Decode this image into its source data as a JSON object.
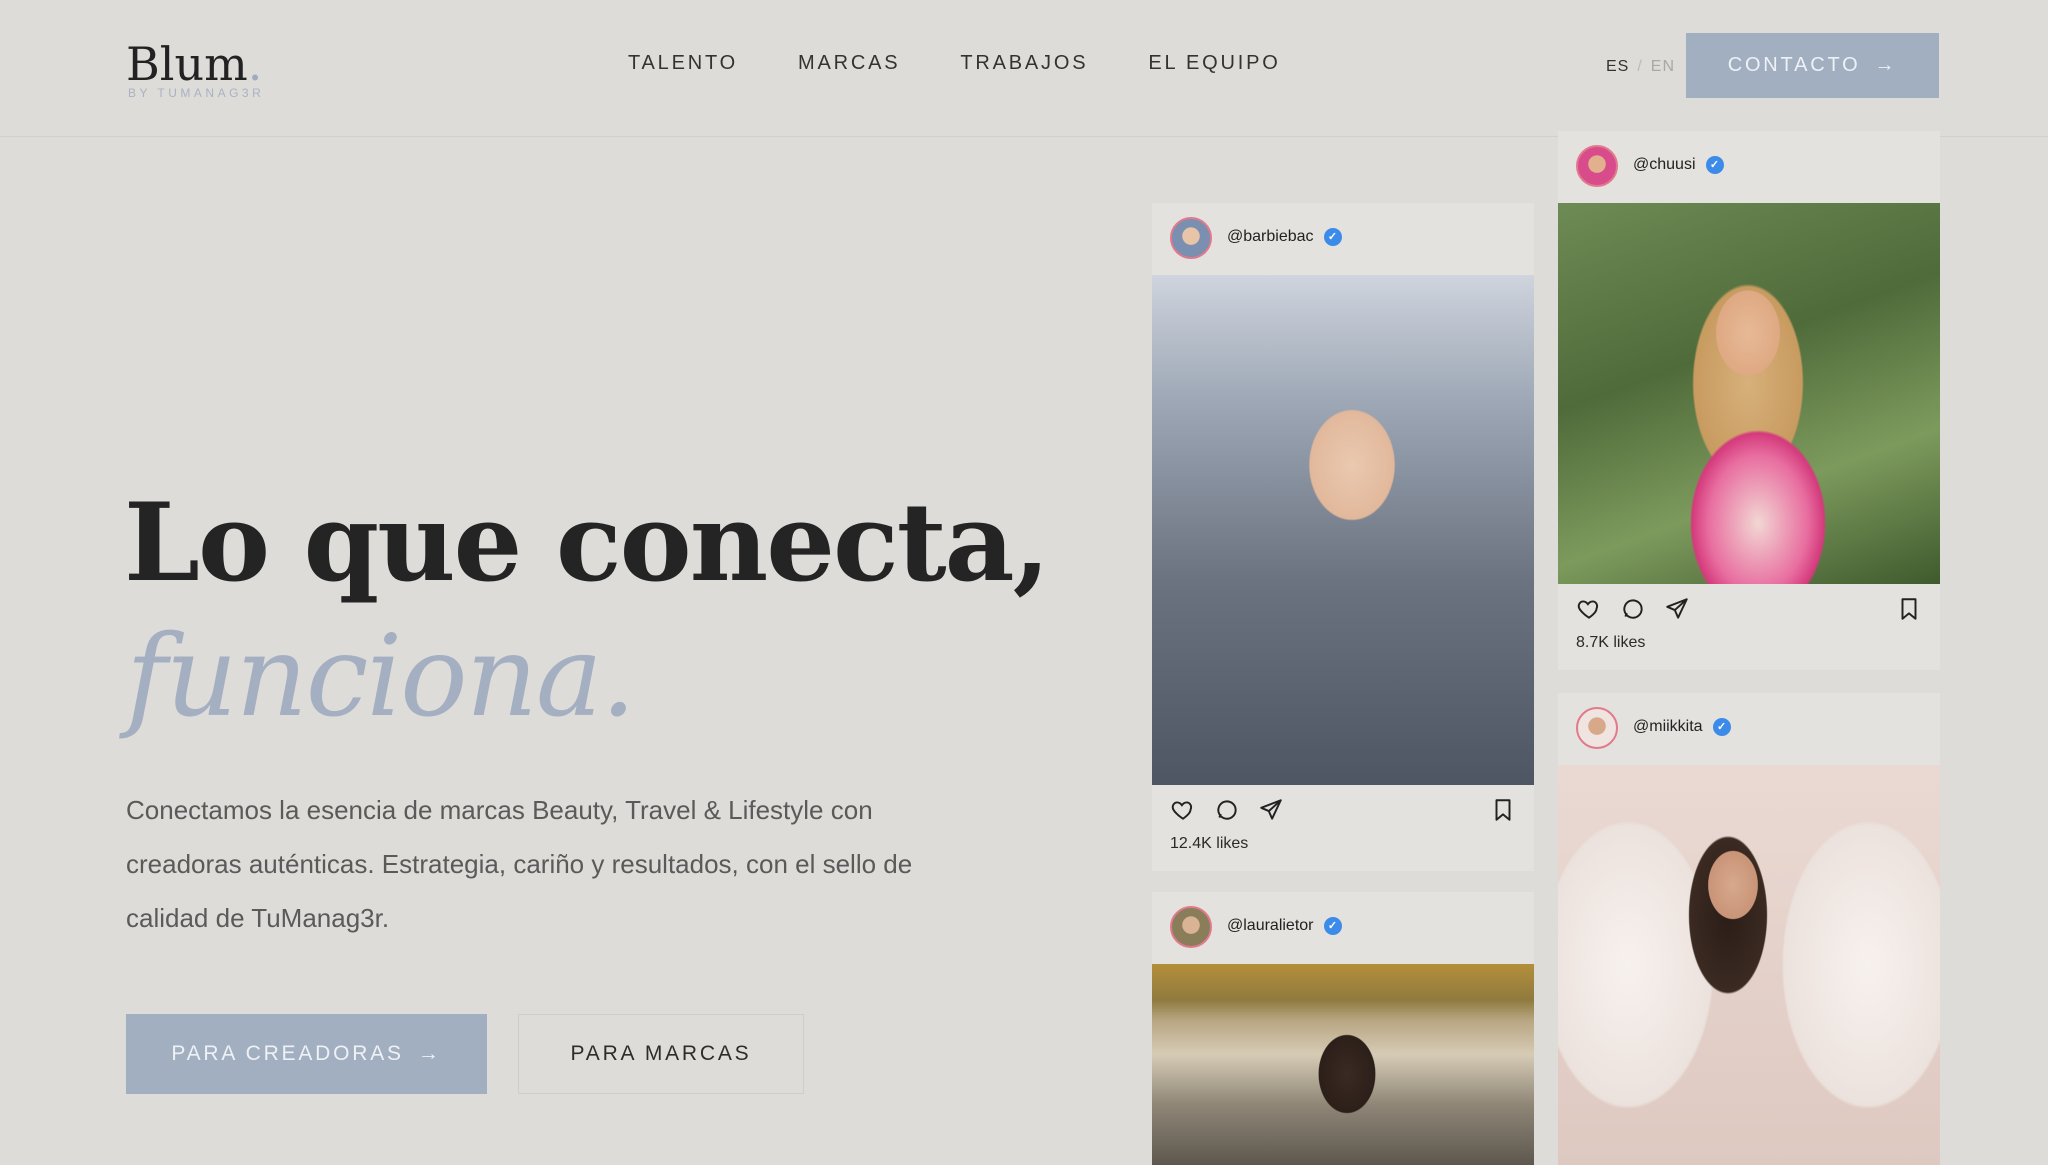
{
  "brand": {
    "name": "Blum",
    "dot": ".",
    "tagline": "BY TUMANAG3R"
  },
  "nav": {
    "items": [
      {
        "label": "TALENTO"
      },
      {
        "label": "MARCAS"
      },
      {
        "label": "TRABAJOS"
      },
      {
        "label": "EL EQUIPO"
      }
    ]
  },
  "language": {
    "active": "ES",
    "separator": "/",
    "inactive": "EN"
  },
  "contact": {
    "label": "CONTACTO",
    "arrow": "→"
  },
  "hero": {
    "title": "Lo que conecta,",
    "title_italic": "funciona.",
    "description": "Conectamos la esencia de marcas Beauty, Travel & Lifestyle con creadoras auténticas. Estrategia, cariño y resultados, con el sello de calidad de TuManag3r.",
    "btn_creators": "PARA CREADORAS",
    "btn_creators_arrow": "→",
    "btn_brands": "PARA MARCAS"
  },
  "cards": [
    {
      "handle": "@barbiebac",
      "likes": "12.4K likes"
    },
    {
      "handle": "@lauralietor",
      "likes": ""
    },
    {
      "handle": "@chuusi",
      "likes": "8.7K likes"
    },
    {
      "handle": "@miikkita",
      "likes": ""
    }
  ],
  "icons": {
    "verified": "✓",
    "heart": "heart-icon",
    "comment": "comment-icon",
    "share": "send-icon",
    "bookmark": "bookmark-icon"
  },
  "colors": {
    "background": "#dedcd8",
    "accent": "#a2afc1",
    "verified": "#3d8be8"
  }
}
